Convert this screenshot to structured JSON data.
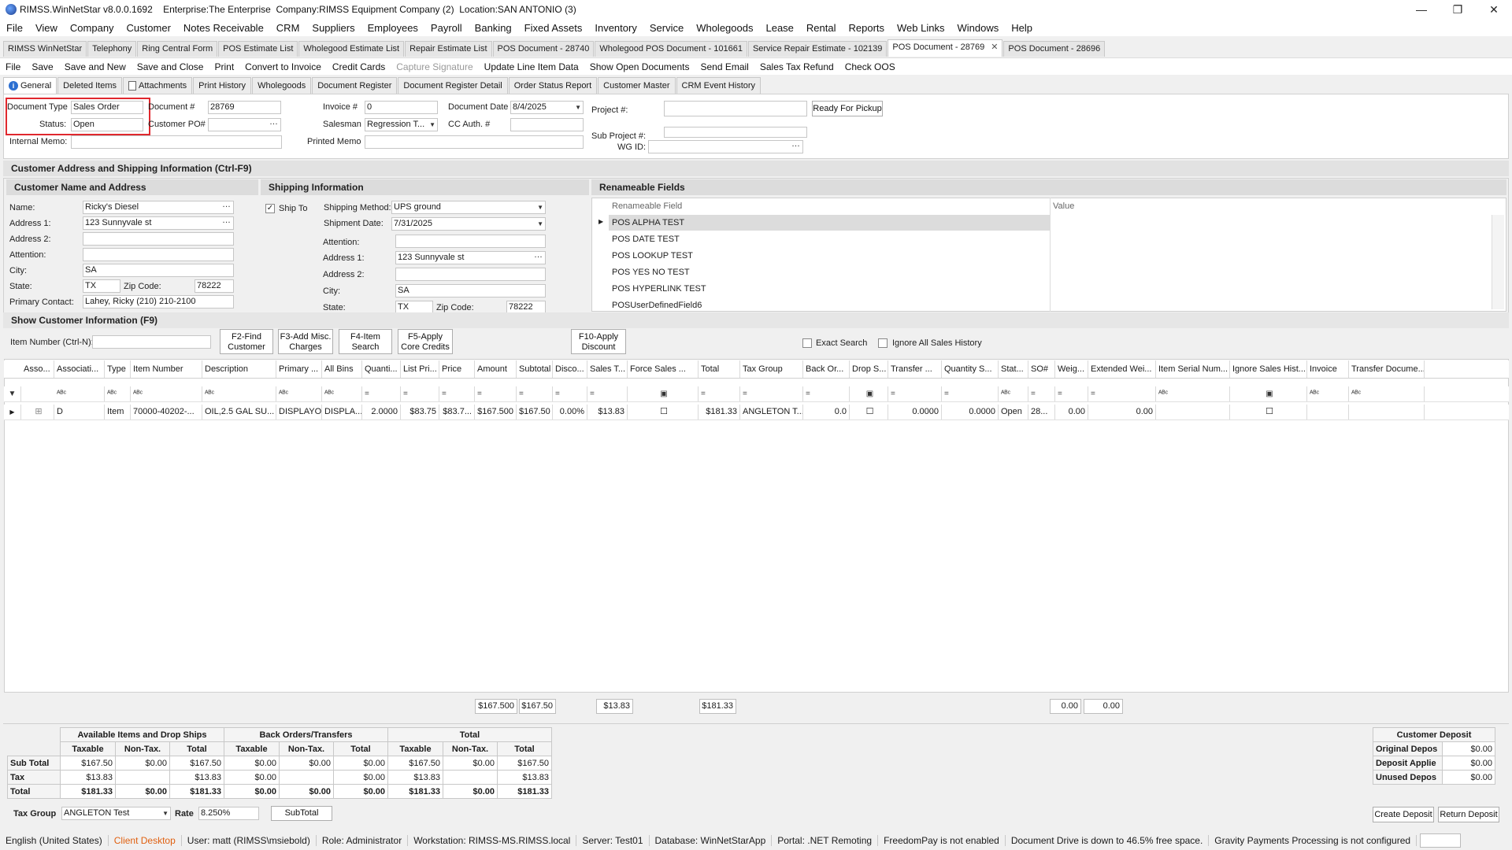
{
  "window": {
    "title": "RIMSS.WinNetStar v8.0.0.1692    Enterprise:The Enterprise  Company:RIMSS Equipment Company (2)  Location:SAN ANTONIO (3)"
  },
  "menu": [
    "File",
    "View",
    "Company",
    "Customer",
    "Notes Receivable",
    "CRM",
    "Suppliers",
    "Employees",
    "Payroll",
    "Banking",
    "Fixed Assets",
    "Inventory",
    "Service",
    "Wholegoods",
    "Lease",
    "Rental",
    "Reports",
    "Web Links",
    "Windows",
    "Help"
  ],
  "tabs": [
    "RIMSS WinNetStar",
    "Telephony",
    "Ring Central Form",
    "POS Estimate List",
    "Wholegood Estimate List",
    "Repair Estimate List",
    "POS Document - 28740",
    "Wholegood POS Document - 101661",
    "Service Repair Estimate - 102139",
    "POS Document - 28769",
    "POS Document - 28696"
  ],
  "toolbar": [
    "File",
    "Save",
    "Save and New",
    "Save and Close",
    "Print",
    "Convert to Invoice",
    "Credit Cards",
    "Capture Signature",
    "Update Line Item Data",
    "Show Open Documents",
    "Send Email",
    "Sales Tax Refund",
    "Check OOS"
  ],
  "subtabs": [
    "General",
    "Deleted Items",
    "Attachments",
    "Print History",
    "Wholegoods",
    "Document Register",
    "Document Register Detail",
    "Order Status Report",
    "Customer Master",
    "CRM Event History"
  ],
  "general": {
    "doc_type_label": "Document Type",
    "doc_type": "Sales Order",
    "status_label": "Status:",
    "status": "Open",
    "internal_memo_label": "Internal Memo:",
    "document_label": "Document #",
    "document": "28769",
    "customer_po_label": "Customer PO#",
    "invoice_label": "Invoice #",
    "invoice": "0",
    "salesman_label": "Salesman",
    "salesman": "Regression T...",
    "printed_memo_label": "Printed Memo",
    "doc_date_label": "Document Date",
    "doc_date": "8/4/2025",
    "cc_auth_label": "CC Auth. #",
    "project_label": "Project #:",
    "sub_project_label": "Sub Project #:",
    "wg_id_label": "WG ID:",
    "ready_btn": "Ready For Pickup"
  },
  "sections": {
    "address": "Customer Address and Shipping Information (Ctrl-F9)",
    "cust_name": "Customer Name and Address",
    "shipping": "Shipping Information",
    "renameable": "Renameable Fields",
    "show_cust": "Show Customer Information (F9)"
  },
  "customer": {
    "name_label": "Name:",
    "name": "Ricky's Diesel",
    "addr1_label": "Address 1:",
    "addr1": "123 Sunnyvale st",
    "addr2_label": "Address 2:",
    "attention_label": "Attention:",
    "city_label": "City:",
    "city": "SA",
    "state_label": "State:",
    "state": "TX",
    "zip_label": "Zip Code:",
    "zip": "78222",
    "contact_label": "Primary Contact:",
    "contact": "Lahey, Ricky (210) 210-2100"
  },
  "shipping": {
    "ship_to_label": "Ship To",
    "method_label": "Shipping Method:",
    "method": "UPS ground",
    "date_label": "Shipment Date:",
    "date": "7/31/2025",
    "attention_label": "Attention:",
    "addr1_label": "Address 1:",
    "addr1": "123 Sunnyvale st",
    "addr2_label": "Address 2:",
    "city_label": "City:",
    "city": "SA",
    "state_label": "State:",
    "state": "TX",
    "zip_label": "Zip Code:",
    "zip": "78222"
  },
  "renameable": {
    "col_field": "Renameable Field",
    "col_value": "Value",
    "rows": [
      "POS ALPHA TEST",
      "POS DATE TEST",
      "POS LOOKUP TEST",
      "POS YES NO TEST",
      "POS HYPERLINK TEST",
      "POSUserDefinedField6"
    ]
  },
  "item_bar": {
    "item_label": "Item Number (Ctrl-N):",
    "f2": "F2-Find Customer",
    "f3": "F3-Add Misc. Charges",
    "f4": "F4-Item Search",
    "f5": "F5-Apply Core Credits",
    "f10": "F10-Apply Discount",
    "exact": "Exact Search",
    "ignore": "Ignore All Sales History"
  },
  "grid": {
    "columns": [
      "Asso...",
      "Associati...",
      "Type",
      "Item Number",
      "Description",
      "Primary ...",
      "All Bins",
      "Quanti...",
      "List Pri...",
      "Price",
      "Amount",
      "Subtotal",
      "Disco...",
      "Sales T...",
      "Force Sales ...",
      "Total",
      "Tax Group",
      "Back Or...",
      "Drop S...",
      "Transfer ...",
      "Quantity S...",
      "Stat...",
      "SO#",
      "Weig...",
      "Extended Wei...",
      "Item Serial Num...",
      "Ignore Sales Hist...",
      "Invoice",
      "Transfer Docume..."
    ],
    "row": [
      "",
      "D",
      "Item",
      "70000-40202-...",
      "OIL,2.5 GAL SU...",
      "DISPLAYO",
      "DISPLA...",
      "2.0000",
      "$83.75",
      "$83.7...",
      "$167.500",
      "$167.50",
      "0.00%",
      "$13.83",
      "",
      "$181.33",
      "ANGLETON T...",
      "0.0",
      "",
      "0.0000",
      "0.0000",
      "Open",
      "28...",
      "0.00",
      "0.00",
      "",
      "",
      "",
      ""
    ],
    "totals": {
      "amount": "$167.500",
      "subtotal": "$167.50",
      "sales_tax": "$13.83",
      "total": "$181.33",
      "weight": "0.00",
      "ext_weight": "0.00"
    }
  },
  "summary": {
    "groups": [
      "Available Items and Drop Ships",
      "Back Orders/Transfers",
      "Total"
    ],
    "subcols": [
      "Taxable",
      "Non-Tax.",
      "Total"
    ],
    "rows": [
      {
        "label": "Sub Total",
        "vals": [
          "$167.50",
          "$0.00",
          "$167.50",
          "$0.00",
          "$0.00",
          "$0.00",
          "$167.50",
          "$0.00",
          "$167.50"
        ]
      },
      {
        "label": "Tax",
        "vals": [
          "$13.83",
          "",
          "$13.83",
          "$0.00",
          "",
          "$0.00",
          "$13.83",
          "",
          "$13.83"
        ]
      },
      {
        "label": "Total",
        "vals": [
          "$181.33",
          "$0.00",
          "$181.33",
          "$0.00",
          "$0.00",
          "$0.00",
          "$181.33",
          "$0.00",
          "$181.33"
        ]
      }
    ],
    "tax_group_label": "Tax Group",
    "tax_group": "ANGLETON Test",
    "rate_label": "Rate",
    "rate": "8.250%",
    "subtotal_btn": "SubTotal"
  },
  "deposit": {
    "title": "Customer Deposit",
    "rows": [
      {
        "label": "Original Depos",
        "val": "$0.00"
      },
      {
        "label": "Deposit Applie",
        "val": "$0.00"
      },
      {
        "label": "Unused Depos",
        "val": "$0.00"
      }
    ],
    "create": "Create Deposit",
    "return": "Return Deposit"
  },
  "status": [
    "English (United States)",
    "Client Desktop",
    "User: matt (RIMSS\\msiebold)",
    "Role: Administrator",
    "Workstation: RIMSS-MS.RIMSS.local",
    "Server: Test01",
    "Database: WinNetStarApp",
    "Portal: .NET Remoting",
    "FreedomPay is not enabled",
    "Document Drive is down to 46.5% free space.",
    "Gravity Payments Processing is not configured"
  ],
  "colors": {
    "highlight": "#e0282e",
    "status_warning": "#e06010"
  }
}
